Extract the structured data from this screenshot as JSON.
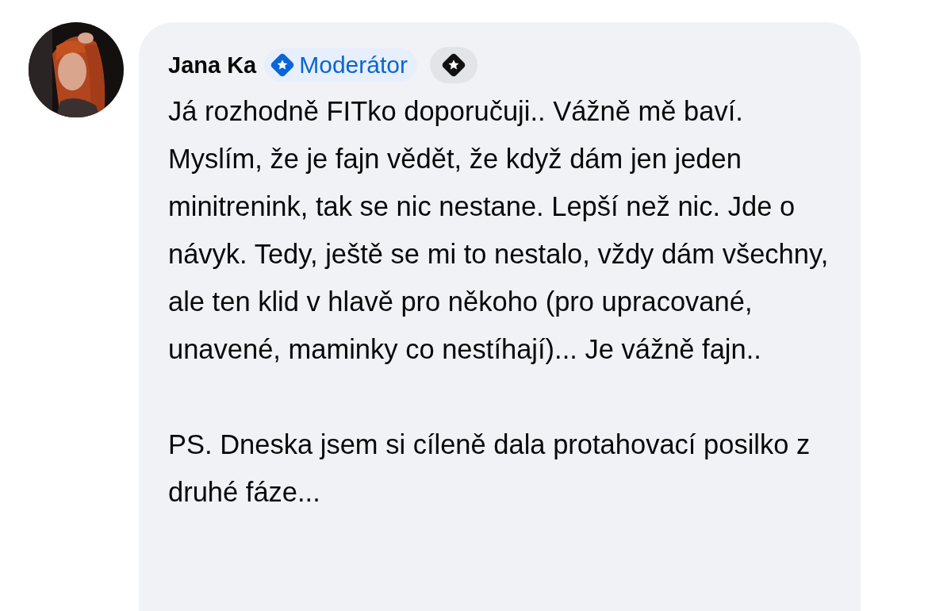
{
  "comment": {
    "author": "Jana Ka",
    "badge": {
      "label": "Moderátor"
    },
    "paragraphs": [
      "Já rozhodně FITko doporučuji.. Vážně mě baví. Myslím, že je fajn vědět, že když dám jen jeden minitrenink, tak se nic nestane. Lepší než nic. Jde o návyk. Tedy, ještě se mi to nestalo, vždy dám všechny, ale ten klid v hlavě pro někoho (pro upracované, unavené, maminky co nestíhají)... Je vážně fajn..",
      "PS. Dneska jsem si cíleně dala protahovací posilko z druhé fáze..."
    ]
  }
}
